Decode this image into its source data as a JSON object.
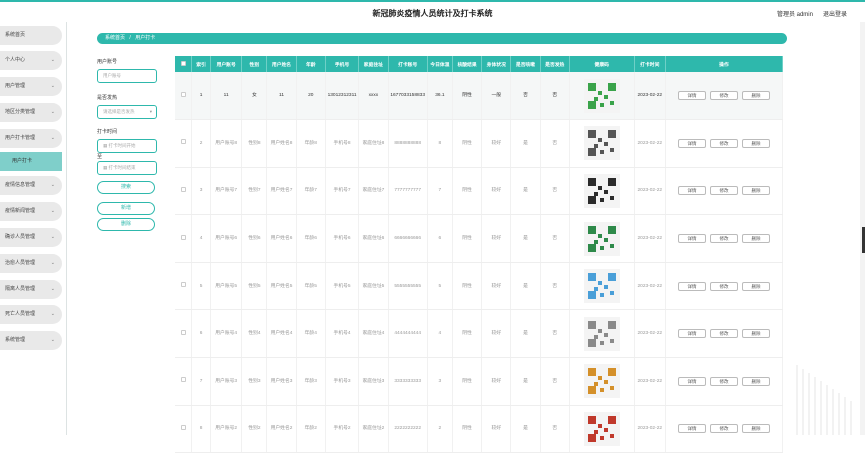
{
  "header": {
    "title": "新冠肺炎疫情人员统计及打卡系统",
    "admin_label": "管理员 admin",
    "logout_label": "退出登录"
  },
  "sidebar": {
    "items": [
      {
        "label": "系统首页",
        "chevron": ""
      },
      {
        "label": "个人中心",
        "chevron": "⌄"
      },
      {
        "label": "用户管理",
        "chevron": "⌄"
      },
      {
        "label": "地区分类管理",
        "chevron": "⌄"
      },
      {
        "label": "用户打卡管理",
        "chevron": "⌄"
      },
      {
        "label": "用户打卡",
        "chevron": ""
      },
      {
        "label": "疫情信息管理",
        "chevron": "⌄"
      },
      {
        "label": "疫情新闻管理",
        "chevron": "⌄"
      },
      {
        "label": "确诊人员管理",
        "chevron": "⌄"
      },
      {
        "label": "治愈人员管理",
        "chevron": "⌄"
      },
      {
        "label": "隔离人员管理",
        "chevron": "⌄"
      },
      {
        "label": "死亡人员管理",
        "chevron": "⌄"
      },
      {
        "label": "系统管理",
        "chevron": "⌄"
      }
    ]
  },
  "breadcrumb": {
    "home": "系统首页",
    "separator": "/",
    "current": "用户打卡"
  },
  "filters": {
    "account_label": "用户账号",
    "account_placeholder": "用户账号",
    "fever_label": "是否发热",
    "fever_placeholder": "请选择是否发热",
    "time_label": "打卡时间",
    "time_start_placeholder": "打卡时间开始",
    "time_end_placeholder": "打卡时间结束",
    "range_sep": "至",
    "search_button": "搜索",
    "add_button": "新增",
    "delete_button": "删除"
  },
  "table": {
    "columns": [
      "",
      "索引",
      "用户账号",
      "性别",
      "用户姓名",
      "年龄",
      "手机号",
      "家庭住址",
      "打卡账号",
      "今日体温",
      "核酸结果",
      "身体状况",
      "是否咳嗽",
      "是否发热",
      "健康码",
      "打卡时间",
      "操作"
    ],
    "actions": {
      "detail": "详情",
      "edit": "修改",
      "delete": "删除"
    },
    "rows": [
      {
        "index": "1",
        "account": "11",
        "gender": "女",
        "name": "11",
        "age": "20",
        "phone": "13012312311",
        "address": "xxxx",
        "card": "1677033158833",
        "temp": "36.1",
        "nucleic": "阴性",
        "health": "一般",
        "cough": "否",
        "fever": "否",
        "qr_color": "#3aa34a",
        "time": "2023-02-22"
      },
      {
        "index": "2",
        "account": "用户账号8",
        "gender": "性别8",
        "name": "用户姓名8",
        "age": "年龄8",
        "phone": "手机号8",
        "address": "家庭住址8",
        "card": "8888888888",
        "temp": "8",
        "nucleic": "阴性",
        "health": "较好",
        "cough": "是",
        "fever": "否",
        "qr_color": "#555555",
        "time": "2023-02-22"
      },
      {
        "index": "3",
        "account": "用户账号7",
        "gender": "性别7",
        "name": "用户姓名7",
        "age": "年龄7",
        "phone": "手机号7",
        "address": "家庭住址7",
        "card": "7777777777",
        "temp": "7",
        "nucleic": "阴性",
        "health": "较好",
        "cough": "是",
        "fever": "否",
        "qr_color": "#2b2b2b",
        "time": "2023-02-22"
      },
      {
        "index": "4",
        "account": "用户账号6",
        "gender": "性别6",
        "name": "用户姓名6",
        "age": "年龄6",
        "phone": "手机号6",
        "address": "家庭住址6",
        "card": "6666666666",
        "temp": "6",
        "nucleic": "阴性",
        "health": "较好",
        "cough": "是",
        "fever": "否",
        "qr_color": "#2e8a4a",
        "time": "2023-02-22"
      },
      {
        "index": "5",
        "account": "用户账号5",
        "gender": "性别5",
        "name": "用户姓名5",
        "age": "年龄5",
        "phone": "手机号5",
        "address": "家庭住址5",
        "card": "5555555555",
        "temp": "5",
        "nucleic": "阴性",
        "health": "较好",
        "cough": "是",
        "fever": "否",
        "qr_color": "#4a9fd8",
        "time": "2023-02-22"
      },
      {
        "index": "6",
        "account": "用户账号4",
        "gender": "性别4",
        "name": "用户姓名4",
        "age": "年龄4",
        "phone": "手机号4",
        "address": "家庭住址4",
        "card": "4444444444",
        "temp": "4",
        "nucleic": "阴性",
        "health": "较好",
        "cough": "是",
        "fever": "否",
        "qr_color": "#8a8a8a",
        "time": "2023-02-22"
      },
      {
        "index": "7",
        "account": "用户账号3",
        "gender": "性别3",
        "name": "用户姓名3",
        "age": "年龄3",
        "phone": "手机号3",
        "address": "家庭住址3",
        "card": "3333333333",
        "temp": "3",
        "nucleic": "阴性",
        "health": "较好",
        "cough": "是",
        "fever": "否",
        "qr_color": "#d4902a",
        "time": "2023-02-22"
      },
      {
        "index": "8",
        "account": "用户账号2",
        "gender": "性别2",
        "name": "用户姓名2",
        "age": "年龄2",
        "phone": "手机号2",
        "address": "家庭住址2",
        "card": "2222222222",
        "temp": "2",
        "nucleic": "阴性",
        "health": "较好",
        "cough": "是",
        "fever": "否",
        "qr_color": "#c0392b",
        "time": "2023-02-22"
      }
    ]
  },
  "theme": {
    "accent": "#2eb8ac",
    "sidebar_bg": "#e9e9e9",
    "active_bg": "#7fcfca"
  }
}
